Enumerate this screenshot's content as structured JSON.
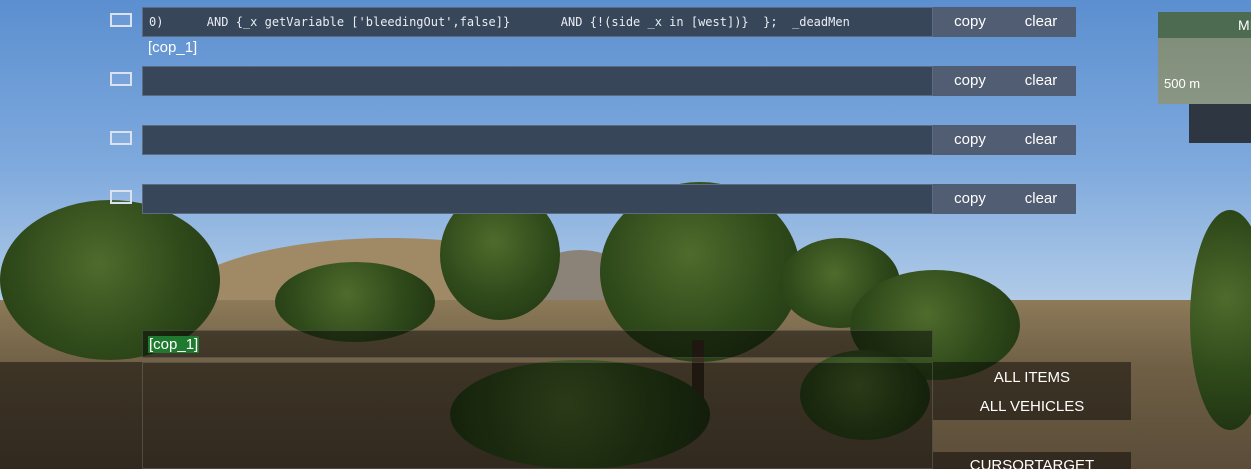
{
  "debug_rows": [
    {
      "value": "0)      AND {_x getVariable ['bleedingOut',false]}       AND {!(side _x in [west])}  };  _deadMen",
      "copy_label": "copy",
      "clear_label": "clear"
    },
    {
      "value": "",
      "copy_label": "copy",
      "clear_label": "clear"
    },
    {
      "value": "",
      "copy_label": "copy",
      "clear_label": "clear"
    },
    {
      "value": "",
      "copy_label": "copy",
      "clear_label": "clear"
    }
  ],
  "result_tag": "[cop_1]",
  "selected_tag": "[cop_1]",
  "side_list": {
    "items": [
      "ALL ITEMS",
      "ALL VEHICLES",
      "CURSORTARGET"
    ]
  },
  "map": {
    "header_label": "MI",
    "scale_label": "500 m"
  },
  "colors": {
    "field_bg": "#38465a",
    "button_bg": "#505d72",
    "selected_tag_bg": "#1f7a2f"
  }
}
